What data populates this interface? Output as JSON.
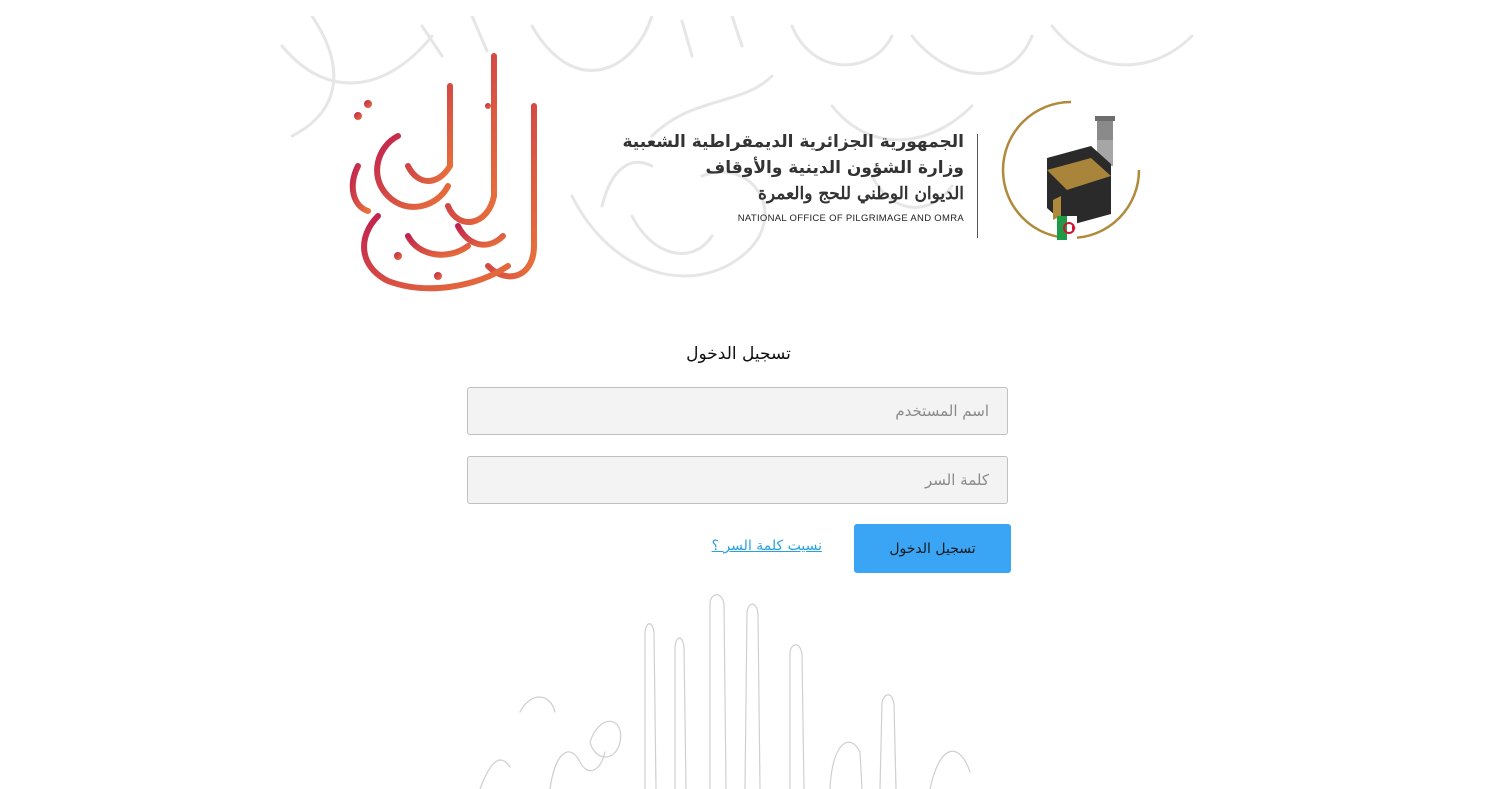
{
  "header": {
    "slogan_calligraphy_text": "وأتموا الحج والعمرة لله",
    "ministry_lines": [
      "الجمهورية الجزائرية الديمقراطية الشعبية",
      "وزارة الشؤون الدينية والأوقاف",
      "الديوان الوطني للحج والعمرة",
      "NATIONAL OFFICE OF PILGRIMAGE AND OMRA"
    ],
    "logo_icon": "kaaba-crescent-logo"
  },
  "login": {
    "title": "تسجيل الدخول",
    "username_placeholder": "اسم المستخدم",
    "password_placeholder": "كلمة السر",
    "submit_label": "تسجيل الدخول",
    "forgot_label": "نسيت كلمة السر ؟"
  },
  "colors": {
    "primary_button": "#3aa4f5",
    "link": "#26a3dc",
    "field_bg": "#f3f3f3",
    "calligraphy_start": "#c0224f",
    "calligraphy_end": "#e9733a",
    "logo_green": "#1f9b47",
    "logo_gold": "#b08a3c"
  }
}
